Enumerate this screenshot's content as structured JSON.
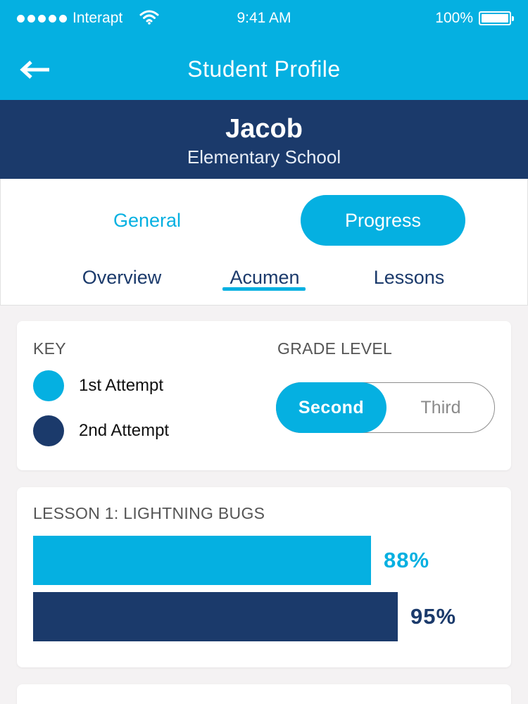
{
  "status_bar": {
    "carrier": "Interapt",
    "time": "9:41 AM",
    "battery": "100%"
  },
  "header": {
    "title": "Student Profile"
  },
  "profile": {
    "name": "Jacob",
    "school": "Elementary School"
  },
  "tabs": {
    "general": "General",
    "progress": "Progress",
    "active": "Progress"
  },
  "subtabs": {
    "overview": "Overview",
    "acumen": "Acumen",
    "lessons": "Lessons",
    "active": "Acumen"
  },
  "key_card": {
    "key_label": "KEY",
    "legend": [
      {
        "label": "1st Attempt",
        "color": "#05b0e1"
      },
      {
        "label": "2nd Attempt",
        "color": "#1b3a6b"
      }
    ],
    "grade_label": "GRADE LEVEL",
    "grade_options": [
      "Second",
      "Third"
    ],
    "grade_selected": "Second"
  },
  "lessons": [
    {
      "title": "LESSON 1: LIGHTNING BUGS",
      "attempts": [
        {
          "label": "88%",
          "value": 88,
          "color": "#05b0e1"
        },
        {
          "label": "95%",
          "value": 95,
          "color": "#1b3a6b"
        }
      ]
    }
  ],
  "colors": {
    "accent": "#05b0e1",
    "navy": "#1b3a6b",
    "background": "#f4f2f3"
  }
}
